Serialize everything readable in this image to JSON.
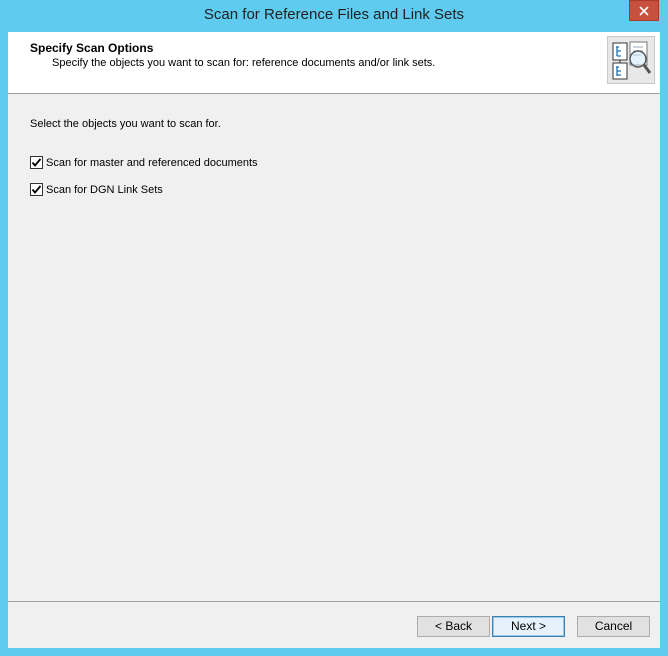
{
  "window": {
    "title": "Scan for Reference Files and Link Sets",
    "close_icon": "close-icon"
  },
  "header": {
    "title": "Specify Scan Options",
    "subtitle": "Specify the objects you want to scan for: reference documents and/or link sets.",
    "icon": "scan-documents-icon"
  },
  "main": {
    "instruction": "Select the objects you want to scan for.",
    "options": [
      {
        "label": "Scan for master and referenced documents",
        "checked": true
      },
      {
        "label": "Scan for DGN Link Sets",
        "checked": true
      }
    ]
  },
  "buttons": {
    "back": "< Back",
    "next": "Next >",
    "cancel": "Cancel"
  },
  "colors": {
    "frame": "#5ecbef",
    "close": "#c7503f",
    "dialog_bg": "#f0f0f0",
    "default_button_border": "#3c7fb1"
  }
}
